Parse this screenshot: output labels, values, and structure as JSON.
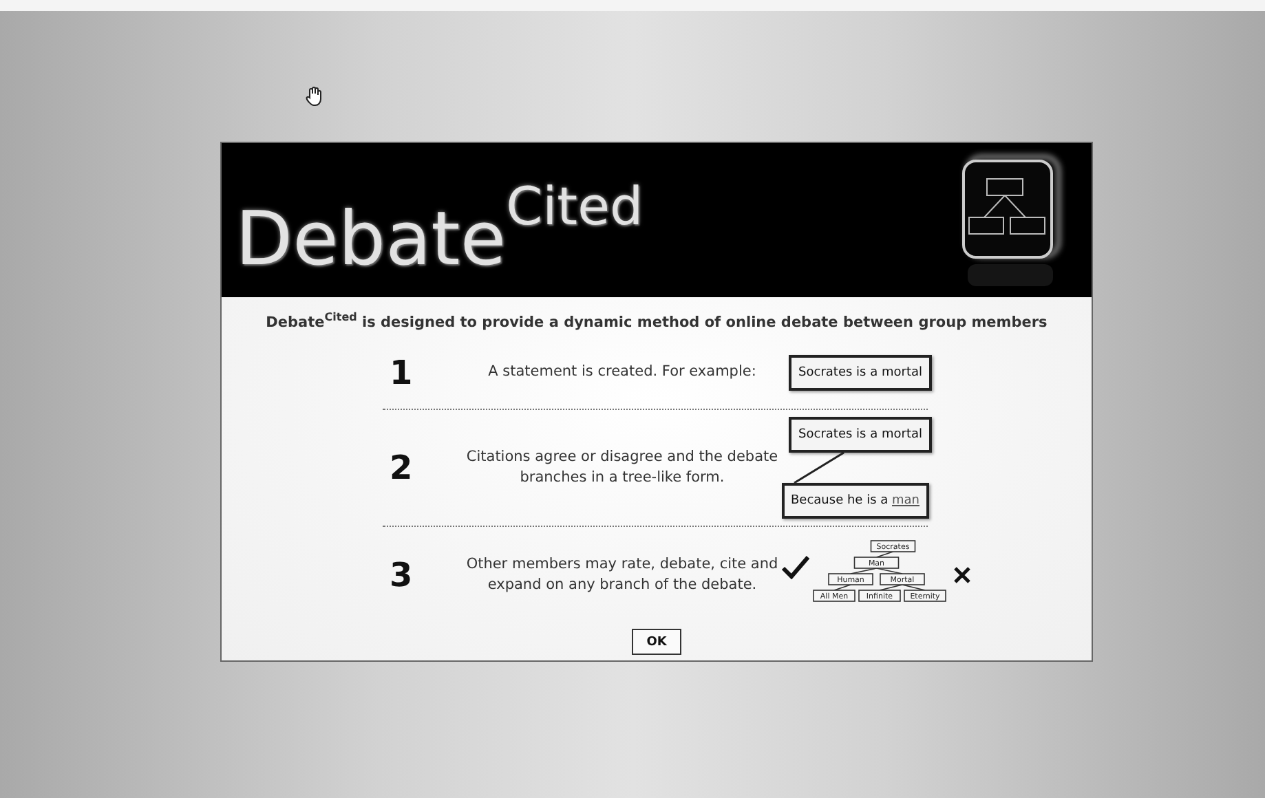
{
  "header": {
    "title": "Debate",
    "superscript": "Cited"
  },
  "intro": "Debate$^{Cited}$ is designed to provide a dynamic method of online debate between group members",
  "steps": [
    {
      "kind": "statement",
      "number": "1",
      "text": "A statement is created. For example:",
      "statement": "Socrates is a mortal"
    },
    {
      "kind": "citation",
      "number": "2",
      "text": "Citations agree or disagree and the debate branches in a tree-like form.",
      "statement": "Socrates is a mortal",
      "citation": "Because he is a ",
      "citation_link": "man"
    },
    {
      "kind": "tree",
      "number": "3",
      "text": "Other members may rate, debate, cite and expand on any branch of the debate.",
      "tree": {
        "label": "Socrates",
        "children": [
          {
            "label": "Man",
            "children": [
              {
                "label": "Human",
                "children": [
                  {
                    "label": "All Men"
                  }
                ]
              },
              {
                "label": "Mortal",
                "children": [
                  {
                    "label": "Infinite"
                  },
                  {
                    "label": "Eternity"
                  }
                ]
              }
            ]
          }
        ]
      }
    }
  ],
  "ok_button": "OK"
}
